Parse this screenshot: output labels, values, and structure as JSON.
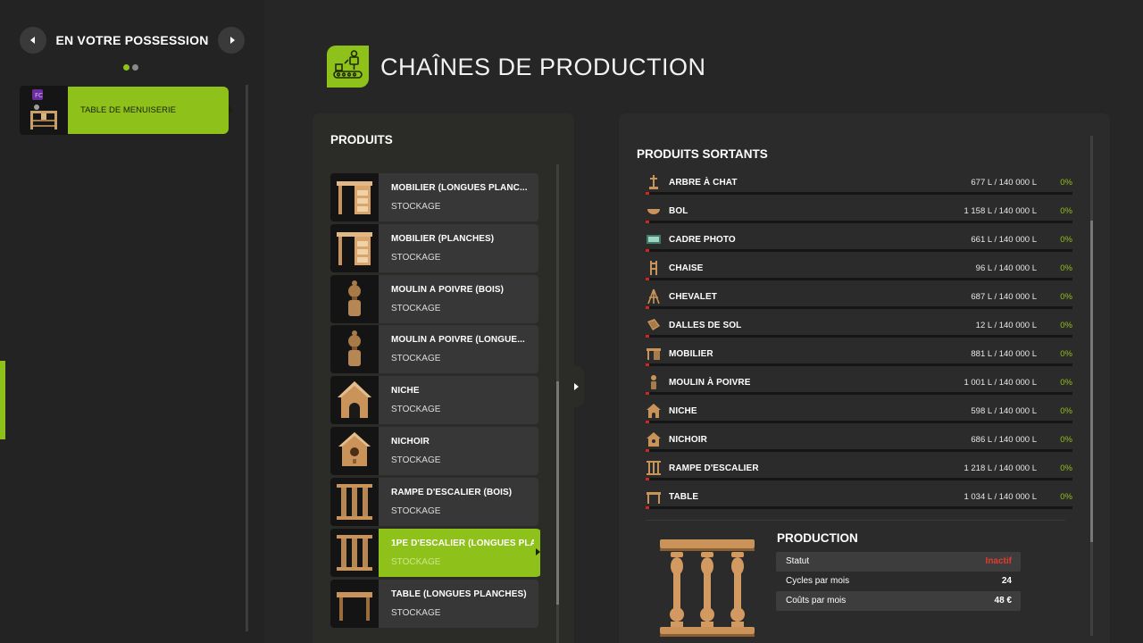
{
  "sidebar": {
    "title": "EN VOTRE POSSESSION",
    "page_dots": [
      {
        "active": true,
        "color": "#8ec21b"
      },
      {
        "active": false,
        "color": "#8a8a8a"
      }
    ],
    "items": [
      {
        "label": "TABLE DE MENUISERIE",
        "selected": true
      }
    ]
  },
  "header": {
    "title": "CHAÎNES DE PRODUCTION",
    "icon": "production-chain-icon"
  },
  "products_panel": {
    "title": "PRODUITS",
    "items": [
      {
        "name": "MOBILIER (LONGUES PLANC...",
        "sub": "STOCKAGE",
        "icon": "desk-icon"
      },
      {
        "name": "MOBILIER (PLANCHES)",
        "sub": "STOCKAGE",
        "icon": "desk-icon"
      },
      {
        "name": "MOULIN À POIVRE (BOIS)",
        "sub": "STOCKAGE",
        "icon": "pepper-mill-icon"
      },
      {
        "name": "MOULIN À POIVRE (LONGUE...",
        "sub": "STOCKAGE",
        "icon": "pepper-mill-icon"
      },
      {
        "name": "NICHE",
        "sub": "STOCKAGE",
        "icon": "doghouse-icon"
      },
      {
        "name": "NICHOIR",
        "sub": "STOCKAGE",
        "icon": "birdhouse-icon"
      },
      {
        "name": "RAMPE D'ESCALIER (BOIS)",
        "sub": "STOCKAGE",
        "icon": "railing-icon"
      },
      {
        "name": "1PE D'ESCALIER (LONGUES PLA",
        "sub": "STOCKAGE",
        "icon": "railing-icon",
        "selected": true
      },
      {
        "name": "TABLE (LONGUES PLANCHES)",
        "sub": "STOCKAGE",
        "icon": "table-icon"
      }
    ]
  },
  "output_panel": {
    "title": "PRODUITS SORTANTS",
    "items": [
      {
        "name": "ARBRE À CHAT",
        "amount": "677 L / 140 000 L",
        "percent": "0%",
        "fill": 0.005,
        "icon": "cat-tree-icon"
      },
      {
        "name": "BOL",
        "amount": "1 158 L / 140 000 L",
        "percent": "0%",
        "fill": 0.008,
        "icon": "bowl-icon"
      },
      {
        "name": "CADRE PHOTO",
        "amount": "661 L / 140 000 L",
        "percent": "0%",
        "fill": 0.005,
        "icon": "photo-frame-icon"
      },
      {
        "name": "CHAISE",
        "amount": "96 L / 140 000 L",
        "percent": "0%",
        "fill": 0.001,
        "icon": "chair-icon"
      },
      {
        "name": "CHEVALET",
        "amount": "687 L / 140 000 L",
        "percent": "0%",
        "fill": 0.005,
        "icon": "easel-icon"
      },
      {
        "name": "DALLES DE SOL",
        "amount": "12 L / 140 000 L",
        "percent": "0%",
        "fill": 0.0001,
        "icon": "floor-tiles-icon"
      },
      {
        "name": "MOBILIER",
        "amount": "881 L / 140 000 L",
        "percent": "0%",
        "fill": 0.006,
        "icon": "furniture-icon"
      },
      {
        "name": "MOULIN À POIVRE",
        "amount": "1 001 L / 140 000 L",
        "percent": "0%",
        "fill": 0.007,
        "icon": "pepper-mill-icon"
      },
      {
        "name": "NICHE",
        "amount": "598 L / 140 000 L",
        "percent": "0%",
        "fill": 0.004,
        "icon": "doghouse-icon"
      },
      {
        "name": "NICHOIR",
        "amount": "686 L / 140 000 L",
        "percent": "0%",
        "fill": 0.005,
        "icon": "birdhouse-icon"
      },
      {
        "name": "RAMPE D'ESCALIER",
        "amount": "1 218 L / 140 000 L",
        "percent": "0%",
        "fill": 0.009,
        "icon": "railing-icon"
      },
      {
        "name": "TABLE",
        "amount": "1 034 L / 140 000 L",
        "percent": "0%",
        "fill": 0.007,
        "icon": "table-icon"
      }
    ]
  },
  "production": {
    "title": "PRODUCTION",
    "image_icon": "staircase-railing-icon",
    "stats": [
      {
        "label": "Statut",
        "value": "Inactif",
        "color": "#e23b2e"
      },
      {
        "label": "Cycles par mois",
        "value": "24"
      },
      {
        "label": "Coûts par mois",
        "value": "48 €"
      }
    ]
  },
  "colors": {
    "accent": "#8ec21b",
    "warning": "#e23b2e",
    "background": "#262626",
    "panel": "#2b2b2b"
  }
}
